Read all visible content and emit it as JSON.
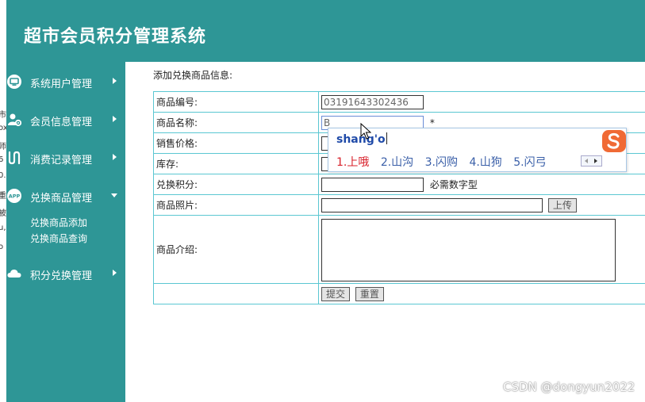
{
  "header": {
    "title": "超市会员积分管理系统"
  },
  "sidebar": {
    "items": [
      {
        "label": "系统用户管理",
        "icon": "monitor-icon"
      },
      {
        "label": "会员信息管理",
        "icon": "user-gear-icon"
      },
      {
        "label": "消费记录管理",
        "icon": "flow-icon"
      },
      {
        "label": "兑换商品管理",
        "icon": "app-icon"
      },
      {
        "label": "积分兑换管理",
        "icon": "cloud-icon"
      }
    ],
    "subitems": [
      "兑换商品添加",
      "兑换商品查询"
    ]
  },
  "main": {
    "title": "添加兑换商品信息:",
    "fields": {
      "code": {
        "label": "商品编号:",
        "value": "03191643302436"
      },
      "name": {
        "label": "商品名称:",
        "value": "B",
        "required_mark": "*"
      },
      "price": {
        "label": "销售价格:"
      },
      "stock": {
        "label": "库存:"
      },
      "points": {
        "label": "兑换积分:",
        "note": "必需数字型"
      },
      "photo": {
        "label": "商品照片:",
        "upload_button": "上传"
      },
      "intro": {
        "label": "商品介绍:"
      }
    },
    "buttons": {
      "submit": "提交",
      "reset": "重置"
    }
  },
  "ime": {
    "composition": "shang'o",
    "candidates": [
      "1.上哦",
      "2.山沟",
      "3.闪购",
      "4.山狗",
      "5.闪弓"
    ]
  },
  "left_edge": [
    "市",
    "ox",
    "师",
    "6",
    "0.",
    "重",
    "被",
    "u,",
    "o"
  ],
  "watermark": "CSDN @dongyun2022",
  "colors": {
    "teal": "#2e9696",
    "table_border": "#5bc7d2",
    "ime_red": "#d8202a",
    "ime_blue": "#3a5fa8",
    "ime_logo": "#f06a35"
  }
}
